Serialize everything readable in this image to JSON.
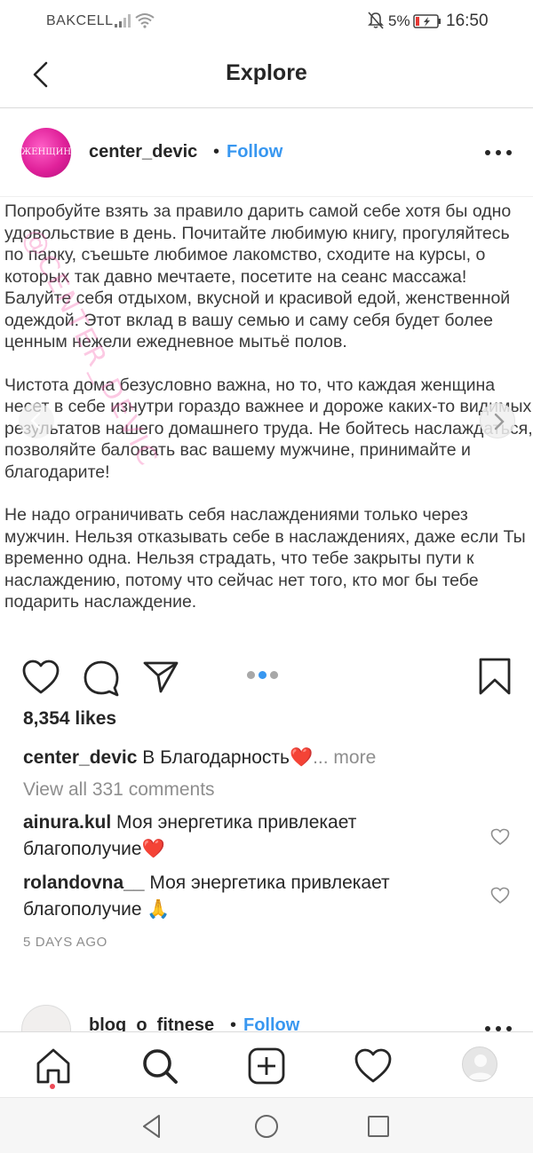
{
  "status_bar": {
    "carrier": "BAKCELL",
    "battery_percent": "5%",
    "time": "16:50",
    "icons": [
      "signal-icon",
      "wifi-icon",
      "bell-muted-icon",
      "battery-icon"
    ]
  },
  "header": {
    "title": "Explore",
    "back_icon": "back-arrow-icon"
  },
  "post": {
    "username": "center_devic",
    "dot": "•",
    "follow_label": "Follow",
    "avatar_text": "ЖЕНЩИНА",
    "watermark": "@CENTER_DEVIC",
    "paragraphs": [
      "Попробуйте взять за правило дарить самой себе хотя бы одно удовольствие в день. Почитайте любимую книгу, прогуляйтесь по парку, съешьте любимое лакомство, сходите на курсы, о которых так давно мечтаете, посетите на сеанс массажа! Балуйте себя отдыхом, вкусной и красивой едой, женственной одеждой. Этот вклад в вашу семью и саму себя будет более ценным нежели ежедневное мытьё полов.",
      "Чистота дома безусловно важна, но то, что каждая женщина несет в себе изнутри гораздо важнее и дороже каких-то видимых результатов нашего домашнего труда. Не бойтесь наслаждаться, позволяйте баловать вас вашему мужчине, принимайте и благодарите!",
      "Не надо ограничивать себя наслаждениями только через мужчин. Нельзя отказывать себе в наслаждениях, даже если Ты временно одна. Нельзя страдать, что тебе закрыты пути к наслаждению, потому что сейчас нет того, кто мог бы тебе подарить наслаждение."
    ],
    "carousel": {
      "total": 3,
      "active_index": 1
    },
    "likes": "8,354 likes",
    "caption_user": "center_devic",
    "caption_text": " В Благодарность❤️",
    "caption_more": "... more",
    "view_all": "View all 331 comments",
    "comments": [
      {
        "user": "ainura.kul",
        "text": " Моя энергетика привлекает благополучие❤️"
      },
      {
        "user": "rolandovna__",
        "text": " Моя энергетика привлекает благополучие 🙏"
      }
    ],
    "time_ago": "5 DAYS AGO"
  },
  "next_post": {
    "username": "blog_o_fitnese",
    "dot": "•",
    "follow_label": "Follow"
  },
  "tabbar": {
    "items": [
      "home-icon",
      "search-icon",
      "new-post-icon",
      "activity-heart-icon",
      "profile-avatar"
    ]
  },
  "colors": {
    "accent": "#3897f0",
    "text": "#262626",
    "muted": "#8e8e8e",
    "notification": "#ed4956"
  }
}
